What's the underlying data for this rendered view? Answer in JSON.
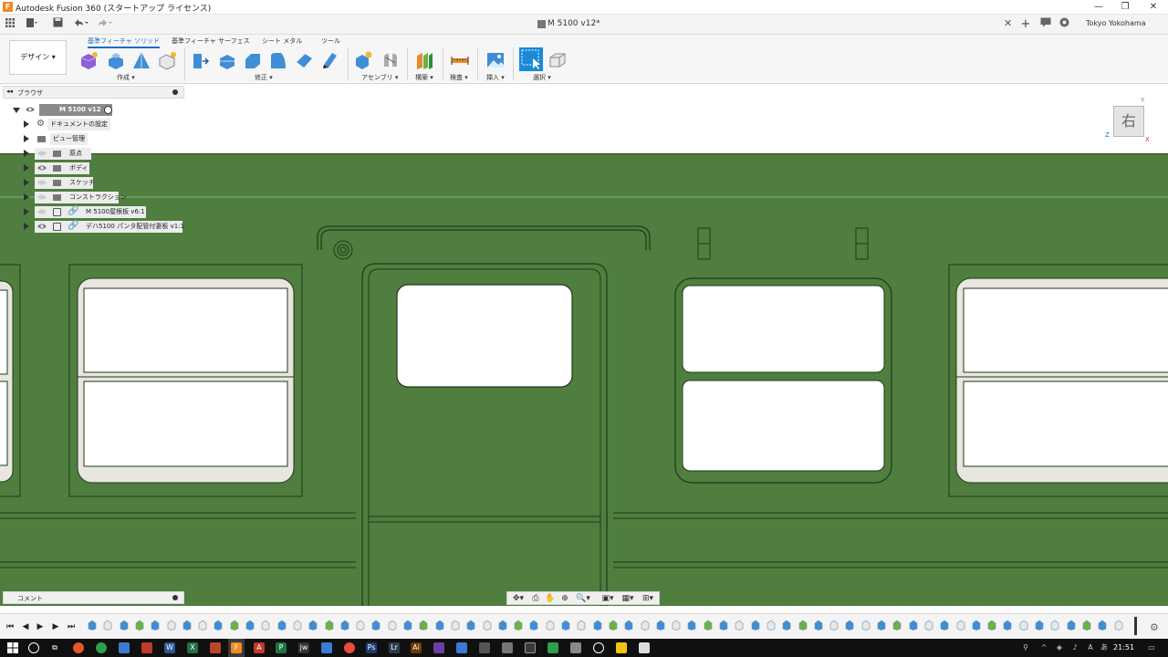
{
  "titlebar": {
    "app_title": "Autodesk Fusion 360 (スタートアップ ライセンス)",
    "logo_letter": "F",
    "minimize": "—",
    "restore": "❐",
    "close": "✕"
  },
  "doc": {
    "title": "M 5100 v12*",
    "close": "✕",
    "new_tab": "+",
    "location": "Tokyo Yokohama"
  },
  "ribbon": {
    "workspace": "デザイン ▾",
    "tabs": [
      "基準フィーチャ ソリッド",
      "基準フィーチャ サーフェス",
      "シート メタル",
      "ツール"
    ],
    "groups": [
      "作成 ▾",
      "修正 ▾",
      "アセンブリ ▾",
      "構築 ▾",
      "検査 ▾",
      "挿入 ▾",
      "選択 ▾"
    ]
  },
  "browser": {
    "header": "ブラウザ",
    "root": "M 5100 v12",
    "items": [
      "ドキュメントの設定",
      "ビュー管理",
      "原点",
      "ボディ",
      "スケッチ",
      "コンストラクション",
      "M 5100屋根板 v6:1",
      "デハ5100 パンタ配管付妻板 v1:1"
    ]
  },
  "viewcube": {
    "face": "右",
    "axis_y": "Y",
    "axis_z": "Z",
    "axis_x": "X"
  },
  "comment": {
    "label": "コメント"
  },
  "timeline": {
    "first": "⏮",
    "prev": "◀",
    "play": "▶",
    "next": "▶",
    "last": "⏭",
    "settings": "⚙"
  },
  "taskbar": {
    "clock": "21:51"
  },
  "colors": {
    "body_green": "#4f7e3f",
    "accent_blue": "#1a6ec2",
    "window_frame": "#e8e6df"
  }
}
